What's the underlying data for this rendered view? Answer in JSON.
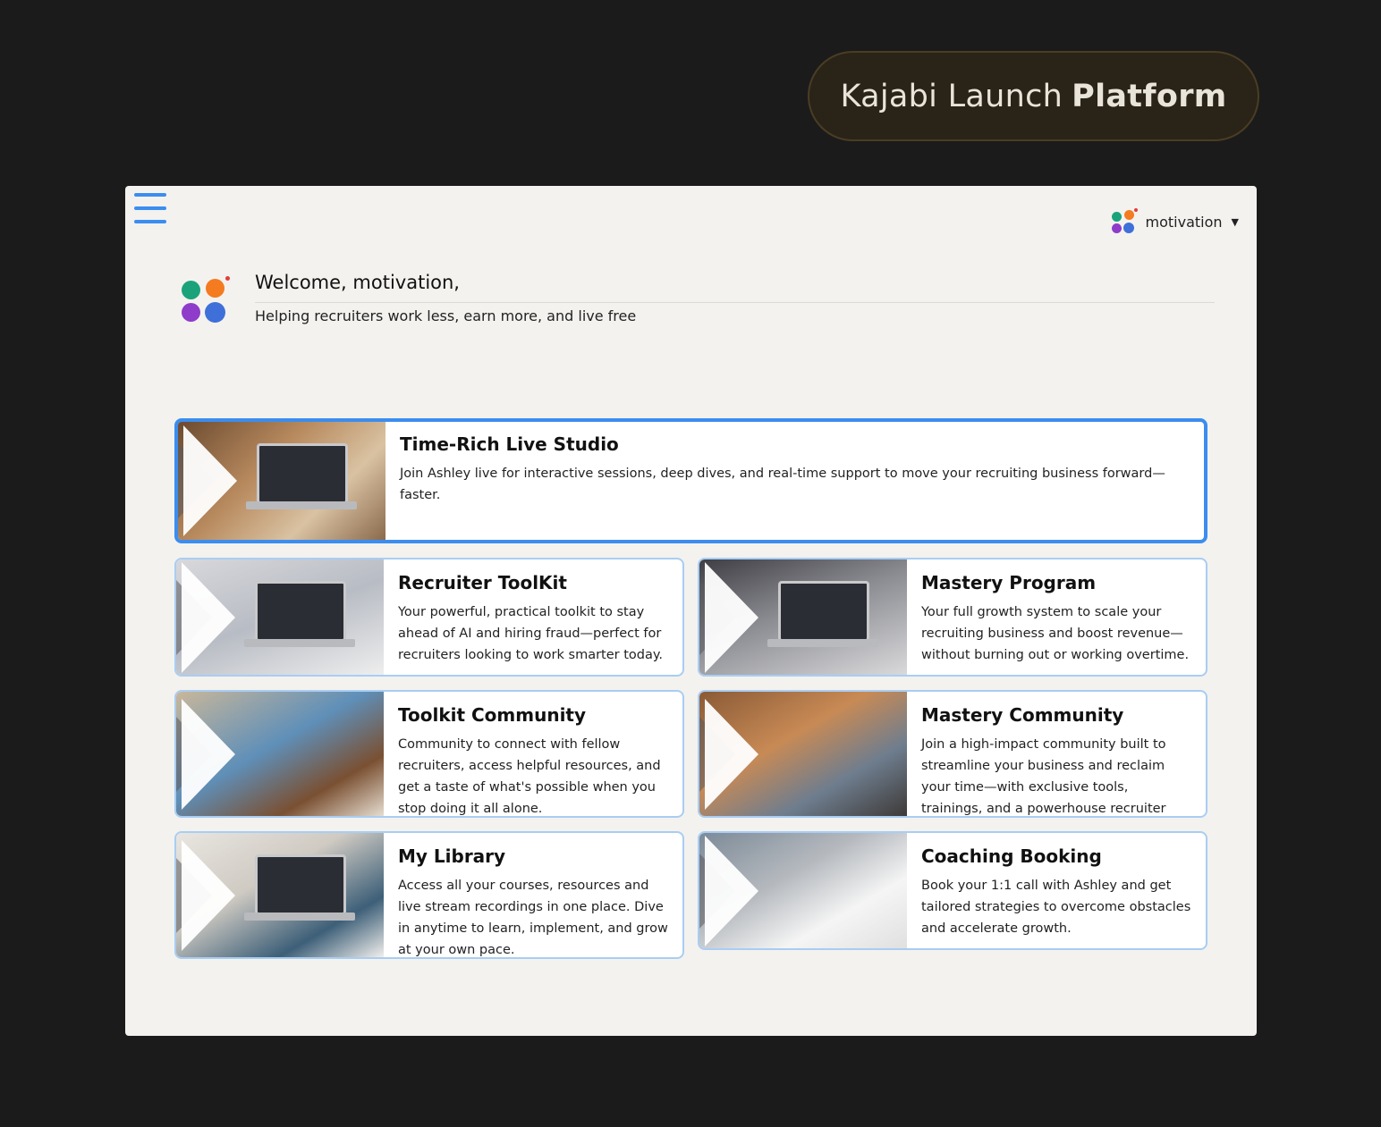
{
  "badge": {
    "light": "Kajabi Launch",
    "bold": "Platform"
  },
  "header": {
    "username": "motivation"
  },
  "welcome": {
    "title": "Welcome, motivation,",
    "subtitle": "Helping recruiters work less, earn more, and live free"
  },
  "featured": {
    "title": "Time-Rich Live Studio",
    "description": "Join Ashley live for interactive sessions, deep dives, and real-time support to move your recruiting business forward—faster."
  },
  "cards": [
    {
      "title": "Recruiter ToolKit",
      "description": "Your powerful, practical toolkit to stay ahead of AI and hiring fraud—perfect for recruiters looking to work smarter today."
    },
    {
      "title": "Mastery Program",
      "description": "Your full growth system to scale your recruiting business and boost revenue—without burning out or working overtime."
    },
    {
      "title": "Toolkit Community",
      "description": "Community to connect with fellow recruiters, access helpful resources, and get a taste of what's possible when you stop doing it all alone."
    },
    {
      "title": "Mastery Community",
      "description": "Join a high-impact community built to streamline your business and reclaim your time—with exclusive tools, trainings, and a powerhouse recruiter network."
    },
    {
      "title": "My Library",
      "description": "Access all your courses, resources and live stream recordings in one place. Dive in anytime to learn, implement, and grow at your own pace."
    },
    {
      "title": "Coaching Booking",
      "description": "Book your 1:1 call with Ashley and get tailored strategies to overcome obstacles and accelerate growth."
    }
  ],
  "colors": {
    "accent": "#3b8def",
    "card_border": "#a9cdf3",
    "page_bg": "#1b1b1b",
    "window_bg": "#f3f2ef"
  },
  "icons": {
    "menu": "hamburger-icon",
    "caret": "caret-down-icon"
  }
}
